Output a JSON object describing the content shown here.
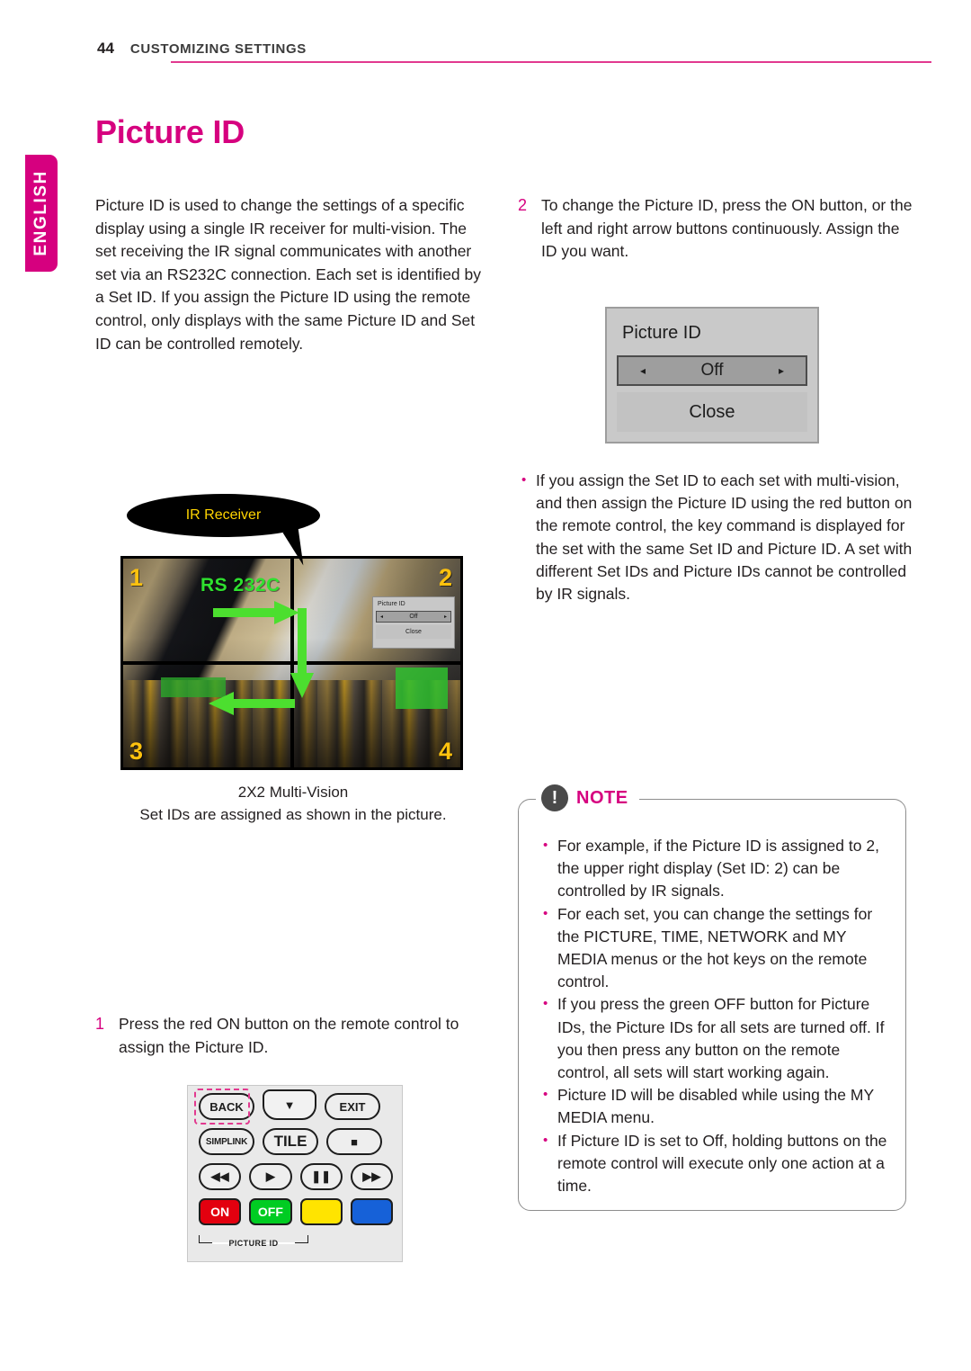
{
  "header": {
    "page_number": "44",
    "section_title": "CUSTOMIZING SETTINGS",
    "rule_color": "#e2398f"
  },
  "language_tab": {
    "label": "ENGLISH",
    "color": "#d6007f"
  },
  "main_heading": {
    "title": "Picture ID",
    "color": "#d6007f"
  },
  "intro": {
    "paragraph": "Picture ID is used to change the settings of a specific display using a single IR receiver for multi-vision. The set receiving the IR signal communicates with another set via an RS232C connection. Each set is identified by a Set ID. If you assign the Picture ID using the remote control, only displays with the same Picture ID and Set ID can be controlled remotely."
  },
  "steps": {
    "step1": {
      "number": "1",
      "text": "Press the red ON button on the remote control to assign the Picture ID."
    },
    "step2": {
      "number": "2",
      "text": "To change the Picture ID, press the ON button, or the left and right arrow buttons continuously. Assign the ID you want."
    }
  },
  "osd_dialog": {
    "title": "Picture ID",
    "value": "Off",
    "arrow_left": "◂",
    "arrow_right": "▸",
    "close_label": "Close"
  },
  "right_bullets": [
    "If you assign the Set ID to each set with multi-vision, and then assign the Picture ID using the red button on the remote control, the key command is displayed for the set with the same Set ID and Picture ID. A set with different Set IDs and Picture IDs cannot be controlled by IR signals."
  ],
  "figure": {
    "ir_callout": "IR Receiver",
    "rs232c_label": "RS 232C",
    "quadrant_numbers": [
      "1",
      "2",
      "3",
      "4"
    ],
    "quadrant_number_color": "#ffc20e",
    "arrow_color": "#4cdf2f",
    "caption_line1": "2X2 Multi-Vision",
    "caption_line2": "Set IDs are assigned as shown in the picture."
  },
  "note": {
    "label": "NOTE",
    "icon": "exclamation-icon",
    "icon_glyph": "!",
    "label_color": "#d6007f",
    "bullets": [
      "For example, if the Picture ID is assigned to 2, the upper right display (Set ID: 2) can be controlled by IR signals.",
      "For each set, you can change the settings for the PICTURE, TIME, NETWORK and MY MEDIA menus or the hot keys on the remote control.",
      "If you press the green OFF button for Picture IDs, the Picture IDs for all sets are turned off. If you then press any button on the remote control, all sets will start working again.",
      "Picture ID will be disabled while using the MY MEDIA menu.",
      "If Picture ID is set to Off, holding buttons on the remote control will execute only one action at a time."
    ]
  },
  "remote": {
    "row1": [
      {
        "label": "BACK",
        "name": "back-button"
      },
      {
        "label": "▼",
        "name": "down-arrow-button"
      },
      {
        "label": "EXIT",
        "name": "exit-button"
      }
    ],
    "row2": [
      {
        "label": "SIMPLINK",
        "name": "simplink-button"
      },
      {
        "label": "TILE",
        "name": "tile-button"
      },
      {
        "label": "■",
        "name": "stop-button"
      }
    ],
    "row3": [
      {
        "label": "◀◀",
        "name": "rewind-button"
      },
      {
        "label": "▶",
        "name": "play-button"
      },
      {
        "label": "❚❚",
        "name": "pause-button"
      },
      {
        "label": "▶▶",
        "name": "fast-forward-button"
      }
    ],
    "color_buttons": [
      {
        "label": "ON",
        "name": "on-button",
        "color": "#e3000f"
      },
      {
        "label": "OFF",
        "name": "off-button",
        "color": "#00cc22"
      },
      {
        "label": "",
        "name": "yellow-button",
        "color": "#ffe400"
      },
      {
        "label": "",
        "name": "blue-button",
        "color": "#1661d8"
      }
    ],
    "picture_id_label": "PICTURE ID",
    "highlight_color": "#e2398f"
  }
}
